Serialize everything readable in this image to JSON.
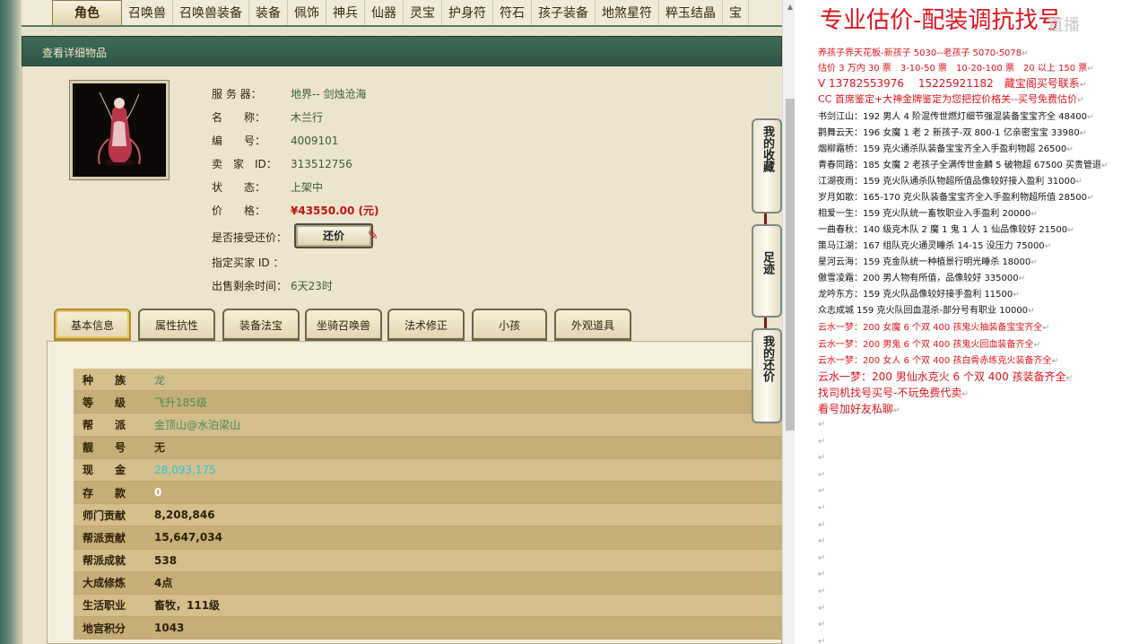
{
  "category_tabs": [
    "角色",
    "召唤兽",
    "召唤兽装备",
    "装备",
    "佩饰",
    "神兵",
    "仙器",
    "灵宝",
    "护身符",
    "符石",
    "孩子装备",
    "地煞星符",
    "粹玉结晶",
    "宝"
  ],
  "detail_header": "查看详细物品",
  "item": {
    "server_label": "服 务 器：",
    "server": "地界-- 剑烛沧海",
    "name_label": "名　　称：",
    "name": "木兰行",
    "number_label": "编　　号：",
    "number": "4009101",
    "seller_label": "卖　家　ID：",
    "seller_id": "313512756",
    "status_label": "状　　态：",
    "status": "上架中",
    "price_label": "价　　格：",
    "price": "¥43550.00 (元)",
    "counter_label": "是否接受还价：",
    "counter_button": "还价",
    "buyer_label": "指定买家 ID ：",
    "remaining_label": "出售剩余时间：",
    "remaining": "6天23时"
  },
  "sub_tabs": [
    "基本信息",
    "属性抗性",
    "装备法宝",
    "坐骑召唤兽",
    "法术修正",
    "小孩",
    "外观道具"
  ],
  "basic_info": [
    {
      "key": "种　　族",
      "value": "龙"
    },
    {
      "key": "等　　级",
      "value": "飞升185级"
    },
    {
      "key": "帮　　派",
      "value": "金顶山@水泊梁山"
    },
    {
      "key": "靓　　号",
      "value": "无"
    },
    {
      "key": "现　　金",
      "value": "28,093,175"
    },
    {
      "key": "存　　款",
      "value": "0"
    },
    {
      "key": "师门贡献",
      "value": "8,208,846"
    },
    {
      "key": "帮派贡献",
      "value": "15,647,034"
    },
    {
      "key": "帮派成就",
      "value": "538"
    },
    {
      "key": "大成修炼",
      "value": "4点"
    },
    {
      "key": "生活职业",
      "value": "畜牧，111级"
    },
    {
      "key": "地宫积分",
      "value": "1043"
    }
  ],
  "side_buttons": {
    "favorites": "我的收藏",
    "footprints": "足迹",
    "my_counter": "我的还价"
  },
  "doc": {
    "title": "专业估价-配装调抗找号",
    "watermark": "直播",
    "para_mark": "↵",
    "lines": [
      "养孩子界天花板-新孩子 5030--老孩子 5070-5078",
      "估价 3 万内 30 票　3-10-50 票　10-20-100 票　20 以上 150 票",
      "V 13782553976　 15225921182　藏宝阁买号联系",
      "CC 首席鉴定+大神金牌鉴定为您把控价格关--买号免费估价",
      "书剑江山：192 男人 4 阶混传世燃灯细节强混装备宝宝齐全 48400",
      "鹳舞云天：196 女魔 1 老 2 新孩子-双 800-1 亿亲密宝宝 33980",
      "烟柳霜桥：159 克火通杀队装备宝宝齐全入手盈利物超 26500",
      "青春同路：185 女魔 2 老孩子全满传世金麟 5 破物超 67500 买贵管退",
      "江湖夜雨：159 克火队通杀队物超所值品像较好接入盈利 31000",
      "岁月如歌：165-170 克火队装备宝宝齐全入手盈利物超所值 28500",
      "相爱一生：159 克火队统一畜牧职业入手盈利 20000",
      "一曲春秋：140 级克木队 2 魔 1 鬼 1 人 1 仙品像较好 21500",
      "策马江湖：167 组队克火通灵睡杀 14-15 没压力 75000",
      "星河云海：159 克金队统一种植景行明光睡杀 18000",
      "傲雪凌霜：200 男人物有所值，品像较好 335000",
      "龙吟东方：159 克火队品像较好接手盈利 11500",
      "众志成城 159 克火队回血混杀-部分号有职业 10000",
      "云水一梦：200 女魔 6 个双 400 孩鬼火抽装备宝宝齐全",
      "云水一梦：200 男鬼 6 个双 400 孩鬼火回血装备齐全",
      "云水一梦：200 女人 6 个双 400 孩白骨赤练克火装备齐全",
      "云水一梦：200 男仙水克火 6 个双 400 孩装备齐全",
      "找司机找号买号-不玩免费代卖",
      "看号加好友私聊"
    ]
  }
}
